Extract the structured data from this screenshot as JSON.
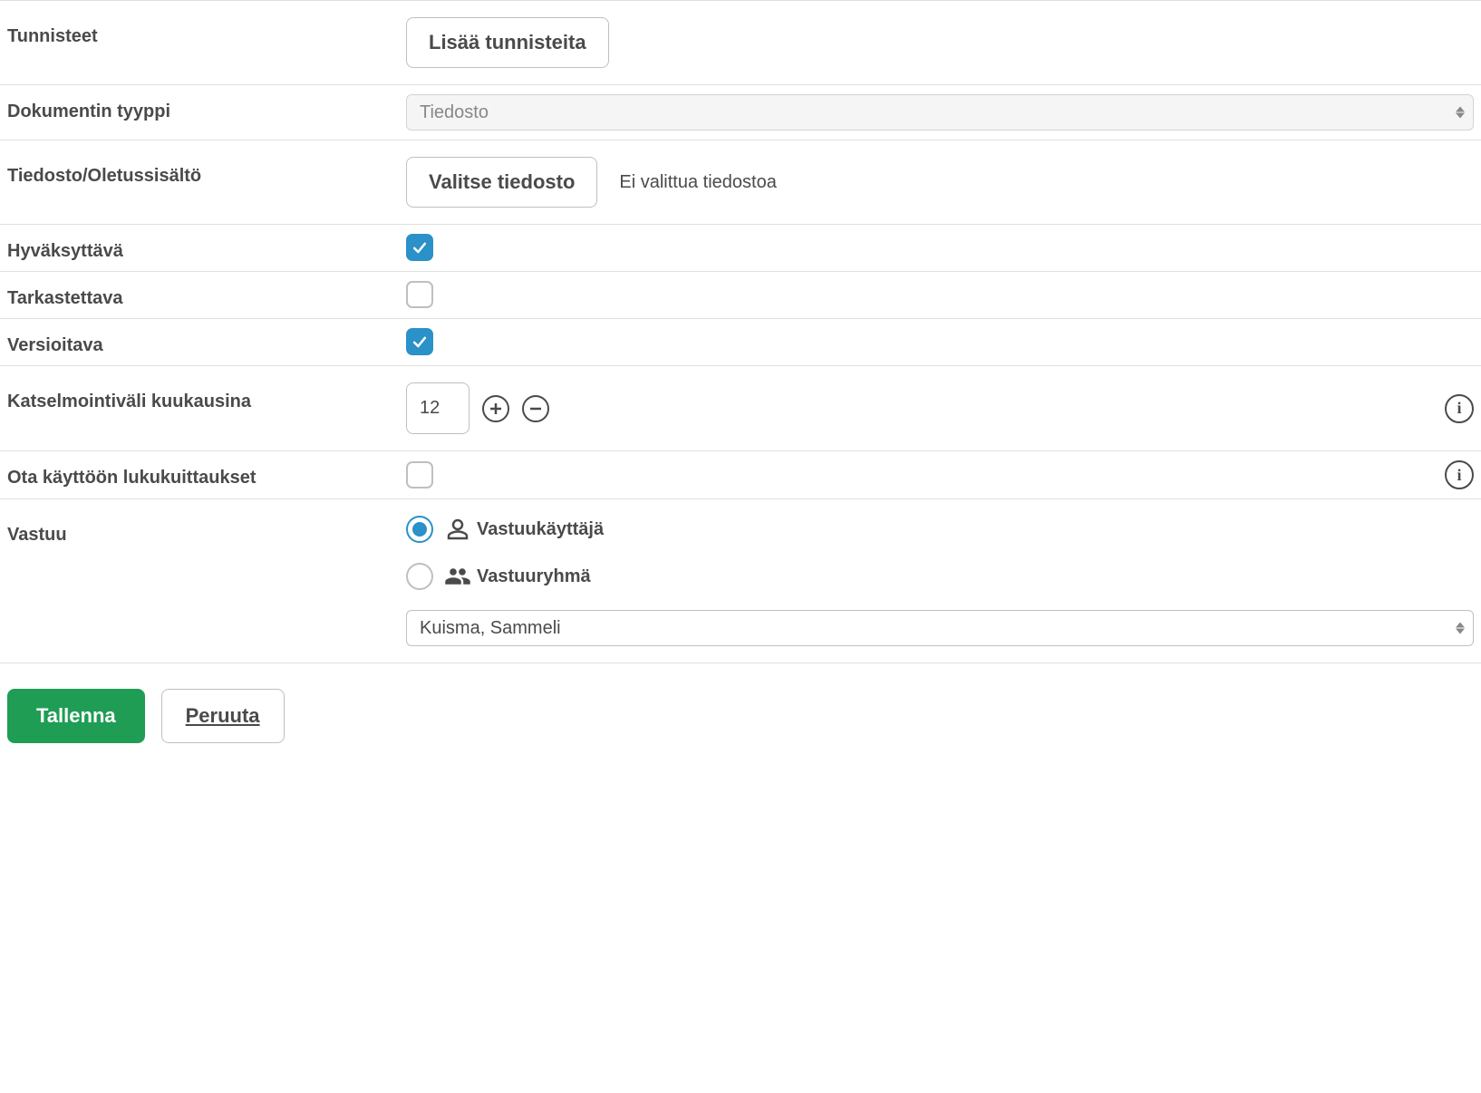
{
  "fields": {
    "tags": {
      "label": "Tunnisteet",
      "button": "Lisää tunnisteita"
    },
    "docType": {
      "label": "Dokumentin tyyppi",
      "value": "Tiedosto"
    },
    "file": {
      "label": "Tiedosto/Oletussisältö",
      "button": "Valitse tiedosto",
      "status": "Ei valittua tiedostoa"
    },
    "approvable": {
      "label": "Hyväksyttävä",
      "checked": true
    },
    "reviewable": {
      "label": "Tarkastettava",
      "checked": false
    },
    "versionable": {
      "label": "Versioitava",
      "checked": true
    },
    "reviewInterval": {
      "label": "Katselmointiväli kuukausina",
      "value": "12"
    },
    "readReceipts": {
      "label": "Ota käyttöön lukukuittaukset",
      "checked": false
    },
    "responsibility": {
      "label": "Vastuu",
      "options": {
        "user": "Vastuukäyttäjä",
        "group": "Vastuuryhmä"
      },
      "selected": "user",
      "personValue": "Kuisma, Sammeli"
    }
  },
  "buttons": {
    "save": "Tallenna",
    "cancel": "Peruuta"
  }
}
